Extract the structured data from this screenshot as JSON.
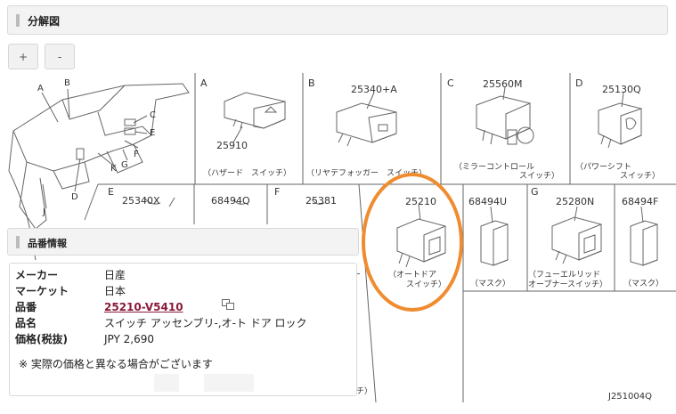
{
  "header": {
    "title": "分解図"
  },
  "zoom": {
    "plus_label": "+",
    "minus_label": "-"
  },
  "overview": {
    "letters": [
      "A",
      "B",
      "C",
      "E",
      "F",
      "G",
      "K",
      "D",
      "J"
    ]
  },
  "diagram": {
    "cells": [
      {
        "letter": "A",
        "part": "25910",
        "caption1": "（ハザード　スイッチ）",
        "caption2": ""
      },
      {
        "letter": "B",
        "part": "25340+A",
        "caption1": "（リヤデフォッガー　スイッチ）",
        "caption2": ""
      },
      {
        "letter": "C",
        "part": "25560M",
        "caption1": "（ミラーコントロール",
        "caption2": "スイッチ）"
      },
      {
        "letter": "D",
        "part": "25130Q",
        "caption1": "（パワーシフト",
        "caption2": "スイッチ）"
      },
      {
        "letter": "E",
        "part": "25340X",
        "caption1": "",
        "caption2": ""
      },
      {
        "letter": "",
        "part": "68494Q",
        "caption1": "",
        "caption2": ""
      },
      {
        "letter": "F",
        "part": "25381",
        "caption1": "",
        "caption2": ""
      },
      {
        "letter": "",
        "part": "25210",
        "caption1": "（オートドア",
        "caption2": "スイッチ）"
      },
      {
        "letter": "",
        "part": "68494U",
        "caption1": "（マスク）",
        "caption2": ""
      },
      {
        "letter": "G",
        "part": "25280N",
        "caption1": "（フューエルリッド",
        "caption2": "オープナースイッチ）"
      },
      {
        "letter": "",
        "part": "68494F",
        "caption1": "（マスク）",
        "caption2": ""
      }
    ],
    "fragment_chi": "チ）",
    "fragment_dash": "ー",
    "ref_code": "J251004Q"
  },
  "info": {
    "title": "品番情報",
    "rows": [
      {
        "key": "メーカー",
        "value": "日産"
      },
      {
        "key": "マーケット",
        "value": "日本"
      },
      {
        "key": "品番",
        "value": "25210-V5410"
      },
      {
        "key": "品名",
        "value": "スイッチ アッセンブリ-,オ-ト ドア ロック"
      },
      {
        "key": "価格(税抜)",
        "value": "JPY 2,690"
      }
    ],
    "note": "※ 実際の価格と異なる場合がございます"
  },
  "colors": {
    "highlight": "#f08c30",
    "part_link": "#8a1b3a"
  }
}
